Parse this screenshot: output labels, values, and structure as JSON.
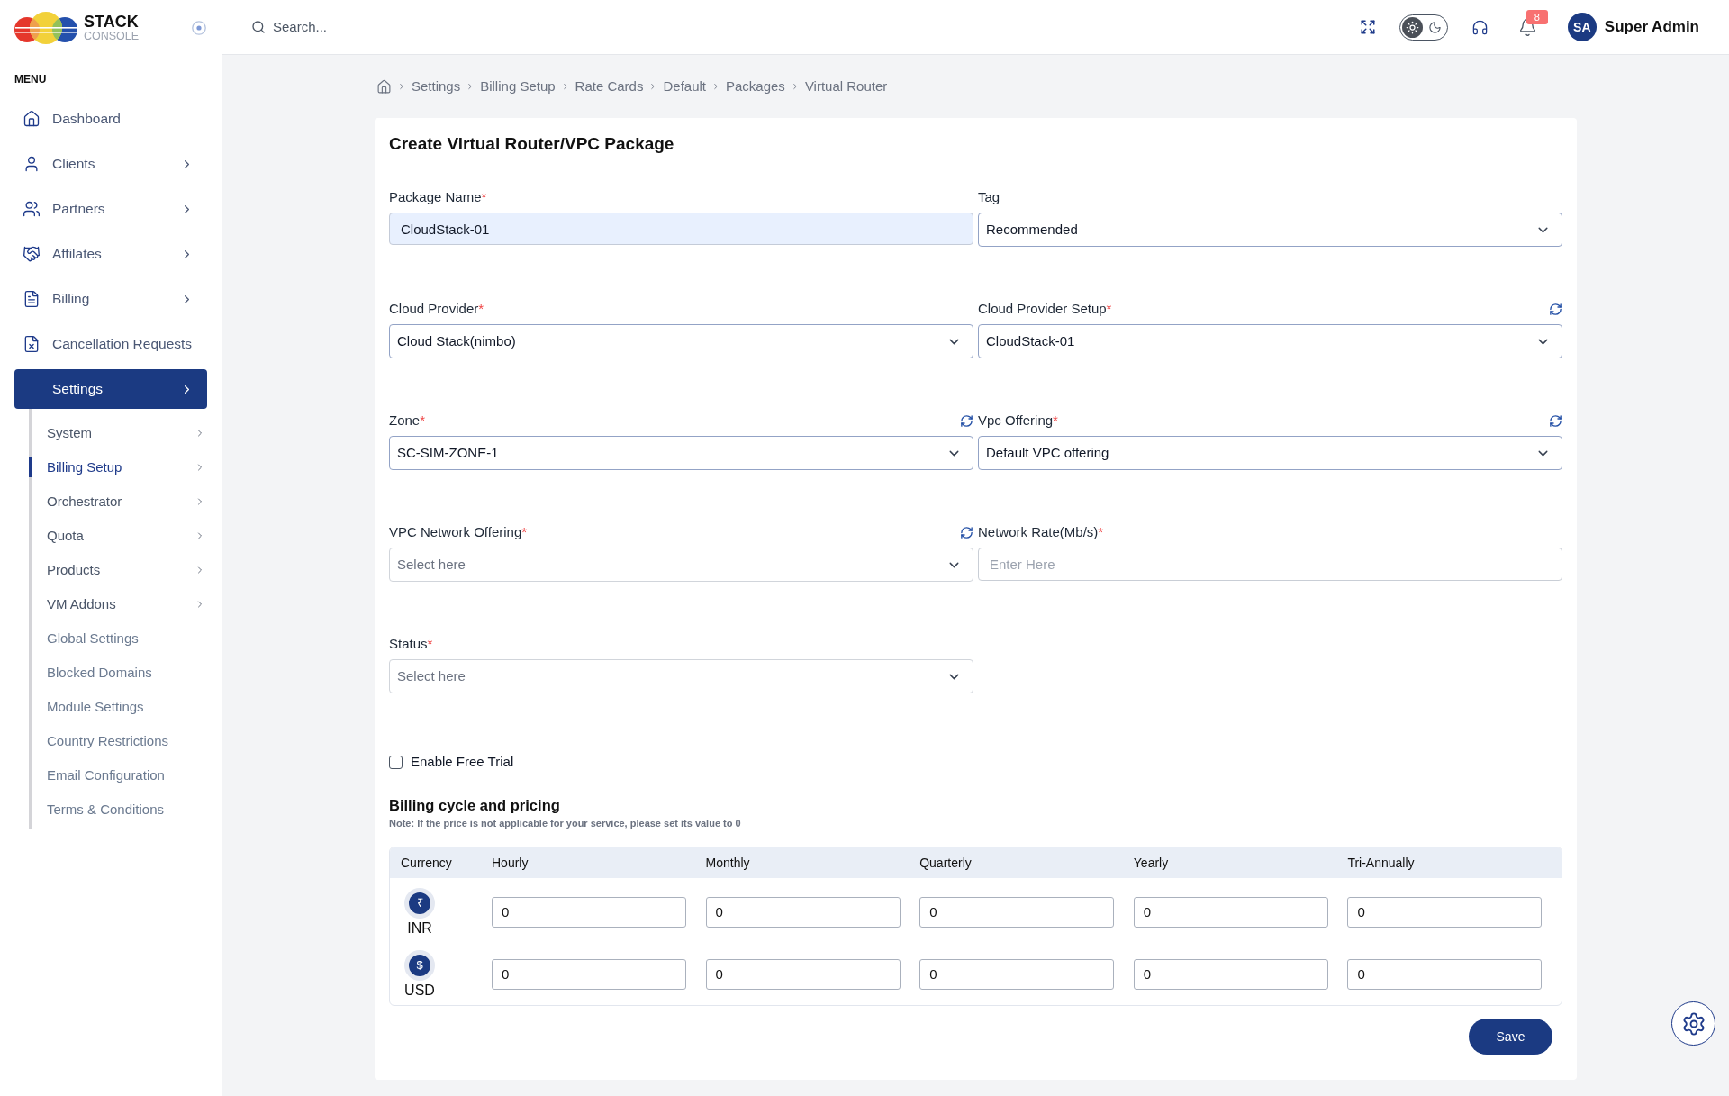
{
  "sidebar": {
    "logo": {
      "name": "STACK",
      "subtitle": "CONSOLE"
    },
    "menu_heading": "MENU",
    "items": [
      {
        "label": "Dashboard",
        "has_submenu": false,
        "selected": false
      },
      {
        "label": "Clients",
        "has_submenu": true,
        "selected": false
      },
      {
        "label": "Partners",
        "has_submenu": true,
        "selected": false
      },
      {
        "label": "Affilates",
        "has_submenu": true,
        "selected": false
      },
      {
        "label": "Billing",
        "has_submenu": true,
        "selected": false
      },
      {
        "label": "Cancellation Requests",
        "has_submenu": false,
        "selected": false
      },
      {
        "label": "Settings",
        "has_submenu": true,
        "selected": true,
        "expanded": true,
        "children": [
          {
            "label": "System",
            "has_submenu": true,
            "selected": false
          },
          {
            "label": "Billing Setup",
            "has_submenu": true,
            "selected": true
          },
          {
            "label": "Orchestrator",
            "has_submenu": true,
            "selected": false
          },
          {
            "label": "Quota",
            "has_submenu": true,
            "selected": false
          },
          {
            "label": "Products",
            "has_submenu": true,
            "selected": false
          },
          {
            "label": "VM Addons",
            "has_submenu": true,
            "selected": false
          },
          {
            "label": "Global Settings",
            "has_submenu": false,
            "selected": false
          },
          {
            "label": "Blocked Domains",
            "has_submenu": false,
            "selected": false
          },
          {
            "label": "Module Settings",
            "has_submenu": false,
            "selected": false
          },
          {
            "label": "Country Restrictions",
            "has_submenu": false,
            "selected": false
          },
          {
            "label": "Email Configuration",
            "has_submenu": false,
            "selected": false
          },
          {
            "label": "Terms & Conditions",
            "has_submenu": false,
            "selected": false
          }
        ]
      }
    ]
  },
  "header": {
    "search": {
      "placeholder": "Search..."
    },
    "dark_mode": false,
    "notifications": "8",
    "user": {
      "initials": "SA",
      "name": "Super Admin"
    }
  },
  "breadcrumb": [
    "Settings",
    "Billing Setup",
    "Rate Cards",
    "Default",
    "Packages",
    "Virtual Router"
  ],
  "form": {
    "title": "Create Virtual Router/VPC Package",
    "fields": [
      {
        "label": "Package Name",
        "required_mark": "*",
        "kind": "text",
        "value": "CloudStack-01",
        "autofilled": true,
        "refresh": false
      },
      {
        "label": "Tag",
        "kind": "select",
        "value": "Recommended",
        "refresh": false
      },
      {
        "label": "Cloud Provider",
        "required_mark": "*",
        "kind": "select",
        "value": "Cloud Stack(nimbo)",
        "refresh": false
      },
      {
        "label": "Cloud Provider Setup",
        "required_mark": "*",
        "kind": "select",
        "value": "CloudStack-01",
        "refresh": true
      },
      {
        "label": "Zone",
        "required_mark": "*",
        "kind": "select",
        "value": "SC-SIM-ZONE-1",
        "refresh": true
      },
      {
        "label": "Vpc Offering",
        "required_mark": "*",
        "kind": "select",
        "value": "Default VPC offering",
        "refresh": true
      },
      {
        "label": "VPC Network Offering",
        "required_mark": "*",
        "kind": "select",
        "placeholder": "Select here",
        "refresh": true
      },
      {
        "label": "Network Rate(Mb/s)",
        "required_mark": "*",
        "kind": "text",
        "placeholder": "Enter Here",
        "autofilled": false,
        "refresh": false
      },
      {
        "label": "Status",
        "required_mark": "*",
        "kind": "select",
        "placeholder": "Select here",
        "refresh": false
      }
    ],
    "free_trial": {
      "label": "Enable Free Trial",
      "checked": false
    }
  },
  "pricing": {
    "title": "Billing cycle and pricing",
    "note": "Note: If the price is not applicable for your service, please set its value to 0",
    "columns": [
      "Currency",
      "Hourly",
      "Monthly",
      "Quarterly",
      "Yearly",
      "Tri-Annually"
    ],
    "rows": [
      {
        "currency": "INR",
        "symbol": "₹",
        "prices": [
          "0",
          "0",
          "0",
          "0",
          "0"
        ]
      },
      {
        "currency": "USD",
        "symbol": "$",
        "prices": [
          "0",
          "0",
          "0",
          "0",
          "0"
        ]
      }
    ]
  },
  "save_button": "Save"
}
